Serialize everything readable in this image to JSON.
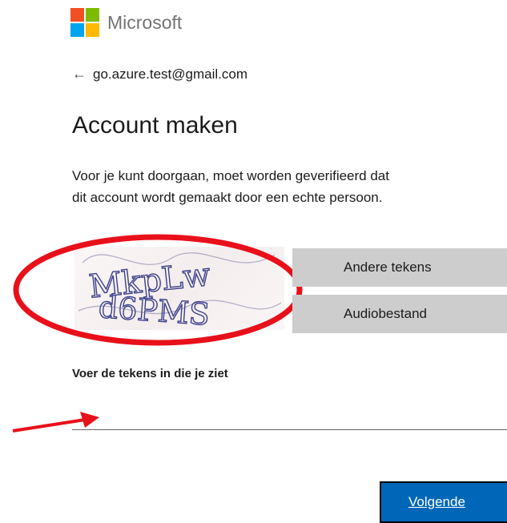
{
  "brand": {
    "name": "Microsoft",
    "logo_colors": [
      "#f25022",
      "#7fba00",
      "#00a4ef",
      "#ffb900"
    ]
  },
  "identity": {
    "back_icon": "back-arrow-icon",
    "email": "go.azure.test@gmail.com"
  },
  "page": {
    "title": "Account maken",
    "description_line1": "Voor je kunt doorgaan, moet worden geverifieerd dat",
    "description_line2": "dit account wordt gemaakt door een echte persoon."
  },
  "captcha": {
    "image_text_line1": "MkpLw",
    "image_text_line2": "d6PMS",
    "other_chars_label": "Andere tekens",
    "audio_label": "Audiobestand",
    "input_label": "Voer de tekens in die je ziet",
    "input_value": ""
  },
  "actions": {
    "next_label": "Volgende"
  },
  "colors": {
    "accent": "#0067b8",
    "annotation": "#e8101a",
    "gray_button": "#cdcdcd"
  }
}
